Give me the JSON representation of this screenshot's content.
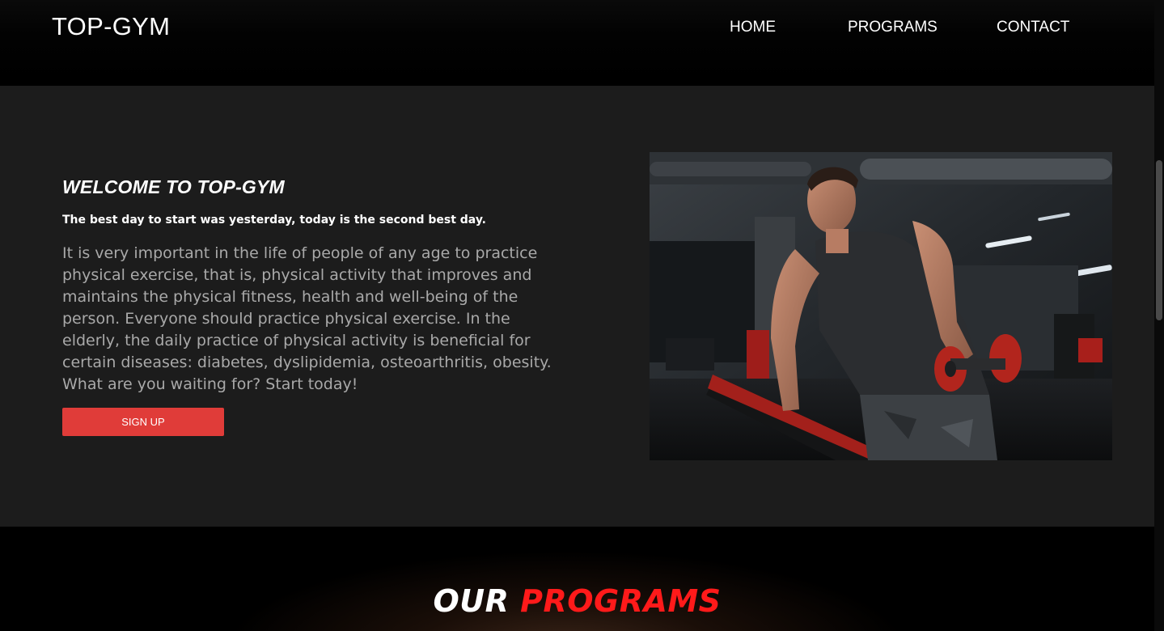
{
  "header": {
    "logo": "TOP-GYM",
    "nav": [
      {
        "label": "HOME"
      },
      {
        "label": "PROGRAMS"
      },
      {
        "label": "CONTACT"
      }
    ]
  },
  "hero": {
    "title": "WELCOME TO TOP-GYM",
    "subtitle": "The best day to start was yesterday, today is the second best day.",
    "body": "It is very important in the life of people of any age to practice physical exercise, that is, physical activity that improves and maintains the physical fitness, health and well-being of the person. Everyone should practice physical exercise. In the elderly, the daily practice of physical activity is beneficial for certain diseases: diabetes, dyslipidemia, osteoarthritis, obesity.",
    "call_to_action": "What are you waiting for? Start today!",
    "signup_label": "SIGN UP",
    "accent_color": "#e03c39"
  },
  "programs": {
    "heading_white": "OUR",
    "heading_red": "PROGRAMS",
    "accent_color": "#ff1a1a"
  }
}
